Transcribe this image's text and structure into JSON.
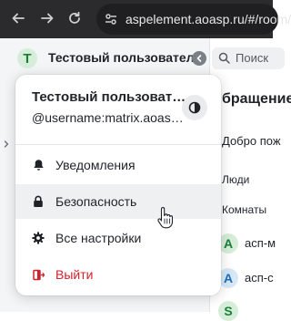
{
  "browser": {
    "url": "aspelement.aoasp.ru/#/room/"
  },
  "header": {
    "avatar_letter": "T",
    "user_name": "Тестовый пользователь"
  },
  "right_panel": {
    "search_label": "Поиск",
    "heading": "бращение",
    "subtitle": "Добро пож",
    "section_people": "Люди",
    "section_rooms": "Комнаты",
    "rooms": [
      {
        "avatar": "A",
        "name": "асп-м"
      },
      {
        "avatar": "A",
        "name": "асп-с"
      },
      {
        "avatar": "S",
        "name": ""
      }
    ]
  },
  "menu": {
    "display_name": "Тестовый пользователь",
    "username": "@username:matrix.aoasp.ru",
    "items": [
      {
        "label": "Уведомления",
        "icon": "bell-icon"
      },
      {
        "label": "Безопасность",
        "icon": "lock-icon"
      },
      {
        "label": "Все настройки",
        "icon": "gear-icon"
      },
      {
        "label": "Выйти",
        "icon": "sign-out-icon"
      }
    ]
  },
  "colors": {
    "danger": "#d11f2b",
    "avatar_bg": "#d6eed9",
    "avatar_fg": "#1a7f37"
  }
}
